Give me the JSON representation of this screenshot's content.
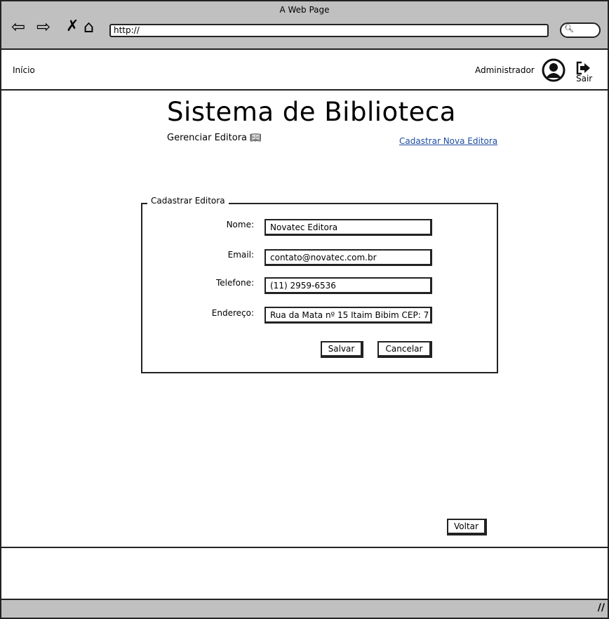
{
  "browser": {
    "title": "A Web Page",
    "url": "http://",
    "icons": [
      "back-arrow-icon",
      "forward-arrow-icon",
      "close-x-icon",
      "home-icon",
      "search-icon"
    ]
  },
  "navbar": {
    "home": "Início",
    "user": "Administrador",
    "logout": "Sair"
  },
  "page": {
    "title": "Sistema de Biblioteca",
    "subtitle": "Gerenciar Editora",
    "new_link": "Cadastrar Nova Editora"
  },
  "form": {
    "legend": "Cadastrar Editora",
    "fields": [
      {
        "label": "Nome:",
        "value": "Novatec Editora"
      },
      {
        "label": "Email:",
        "value": "contato@novatec.com.br"
      },
      {
        "label": "Telefone:",
        "value": "(11) 2959-6536"
      },
      {
        "label": "Endereço:",
        "value": "Rua da Mata  nº 15  Itaim Bibim CEP: 7"
      }
    ],
    "save": "Salvar",
    "cancel": "Cancelar"
  },
  "back": "Voltar",
  "link_color": "#1f4ea1"
}
